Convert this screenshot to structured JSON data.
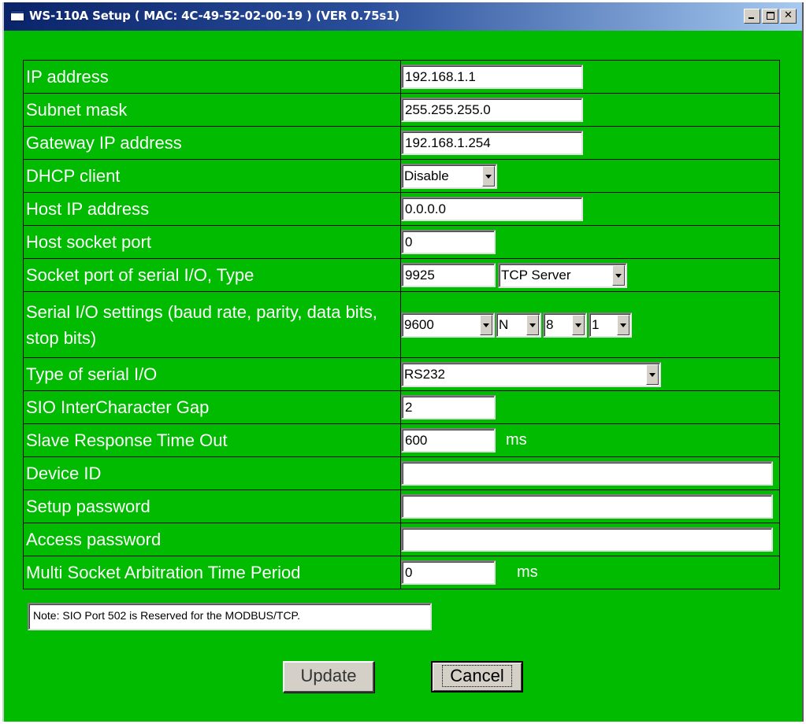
{
  "window": {
    "title": "WS-110A Setup  ( MAC: 4C-49-52-02-00-19 ) (VER 0.75s1)",
    "controls": [
      "minimize",
      "maximize",
      "close"
    ],
    "accent_color": "#00bb00"
  },
  "form": {
    "ip_address": {
      "label": "IP address",
      "value": "192.168.1.1"
    },
    "subnet_mask": {
      "label": "Subnet mask",
      "value": "255.255.255.0"
    },
    "gateway": {
      "label": "Gateway IP address",
      "value": "192.168.1.254"
    },
    "dhcp": {
      "label": "DHCP client",
      "selected": "Disable"
    },
    "host_ip": {
      "label": "Host IP address",
      "value": "0.0.0.0"
    },
    "host_port": {
      "label": "Host socket port",
      "value": "0"
    },
    "socket_port": {
      "label": "Socket port of serial I/O, Type",
      "value": "9925",
      "type_selected": "TCP Server"
    },
    "serial_settings": {
      "label": "Serial I/O settings (baud rate, parity, data bits, stop bits)",
      "baud": "9600",
      "parity": "N",
      "data_bits": "8",
      "stop_bits": "1"
    },
    "serial_type": {
      "label": "Type of serial I/O",
      "selected": "RS232"
    },
    "sio_gap": {
      "label": "SIO InterCharacter Gap",
      "value": "2"
    },
    "slave_timeout": {
      "label": "Slave Response Time Out",
      "value": "600",
      "unit": "ms"
    },
    "device_id": {
      "label": "Device ID",
      "value": ""
    },
    "setup_password": {
      "label": "Setup password",
      "value": ""
    },
    "access_password": {
      "label": "Access password",
      "value": ""
    },
    "multi_socket": {
      "label": "Multi Socket Arbitration Time Period",
      "value": "0",
      "unit": "ms"
    }
  },
  "note": "Note: SIO Port 502 is Reserved for the MODBUS/TCP.",
  "buttons": {
    "update": "Update",
    "cancel": "Cancel"
  }
}
